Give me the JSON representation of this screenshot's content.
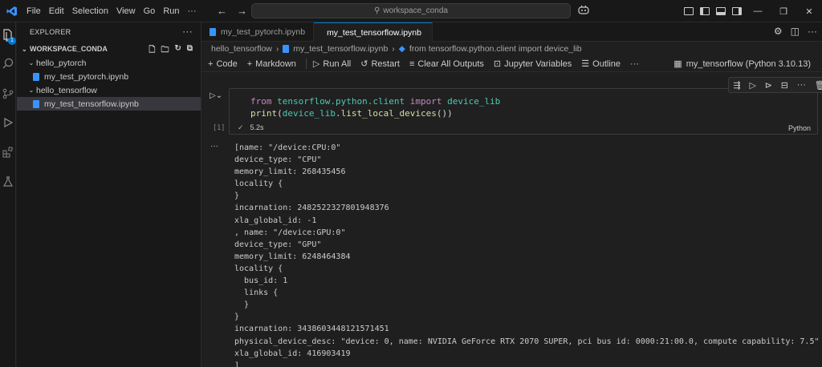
{
  "titlebar": {
    "menu": [
      "File",
      "Edit",
      "Selection",
      "View",
      "Go",
      "Run"
    ],
    "more": "···",
    "search_text": "workspace_conda"
  },
  "activity": {
    "badge": "1"
  },
  "sidebar": {
    "title": "EXPLORER",
    "more": "···",
    "section": "WORKSPACE_CONDA",
    "tree": [
      {
        "label": "hello_pytorch",
        "type": "folder"
      },
      {
        "label": "my_test_pytorch.ipynb",
        "type": "file"
      },
      {
        "label": "hello_tensorflow",
        "type": "folder"
      },
      {
        "label": "my_test_tensorflow.ipynb",
        "type": "file",
        "selected": true
      }
    ]
  },
  "tabs": [
    {
      "label": "my_test_pytorch.ipynb",
      "active": false
    },
    {
      "label": "my_test_tensorflow.ipynb",
      "active": true,
      "dirty": true
    }
  ],
  "breadcrumb": [
    "hello_tensorflow",
    "my_test_tensorflow.ipynb",
    "from tensorflow.python.client import device_lib"
  ],
  "toolbar": {
    "code": "Code",
    "markdown": "Markdown",
    "run_all": "Run All",
    "restart": "Restart",
    "clear_outputs": "Clear All Outputs",
    "variables": "Jupyter Variables",
    "outline": "Outline",
    "more": "···",
    "kernel": "my_tensorflow (Python 3.10.13)"
  },
  "cell": {
    "line1": {
      "kw1": "from",
      "mod": "tensorflow.python.client",
      "kw2": "import",
      "name": "device_lib"
    },
    "line2": {
      "fn": "print",
      "open": "(",
      "obj": "device_lib",
      "dot": ".",
      "method": "list_local_devices",
      "close": "())"
    },
    "exec_count": "[1]",
    "duration": "5.2s",
    "language": "Python",
    "more": "···"
  },
  "output": {
    "more": "···",
    "text": "[name: \"/device:CPU:0\"\ndevice_type: \"CPU\"\nmemory_limit: 268435456\nlocality {\n}\nincarnation: 2482522327801948376\nxla_global_id: -1\n, name: \"/device:GPU:0\"\ndevice_type: \"GPU\"\nmemory_limit: 6248464384\nlocality {\n  bus_id: 1\n  links {\n  }\n}\nincarnation: 3438603448121571451\nphysical_device_desc: \"device: 0, name: NVIDIA GeForce RTX 2070 SUPER, pci bus id: 0000:21:00.0, compute capability: 7.5\"\nxla_global_id: 416903419\n]"
  }
}
